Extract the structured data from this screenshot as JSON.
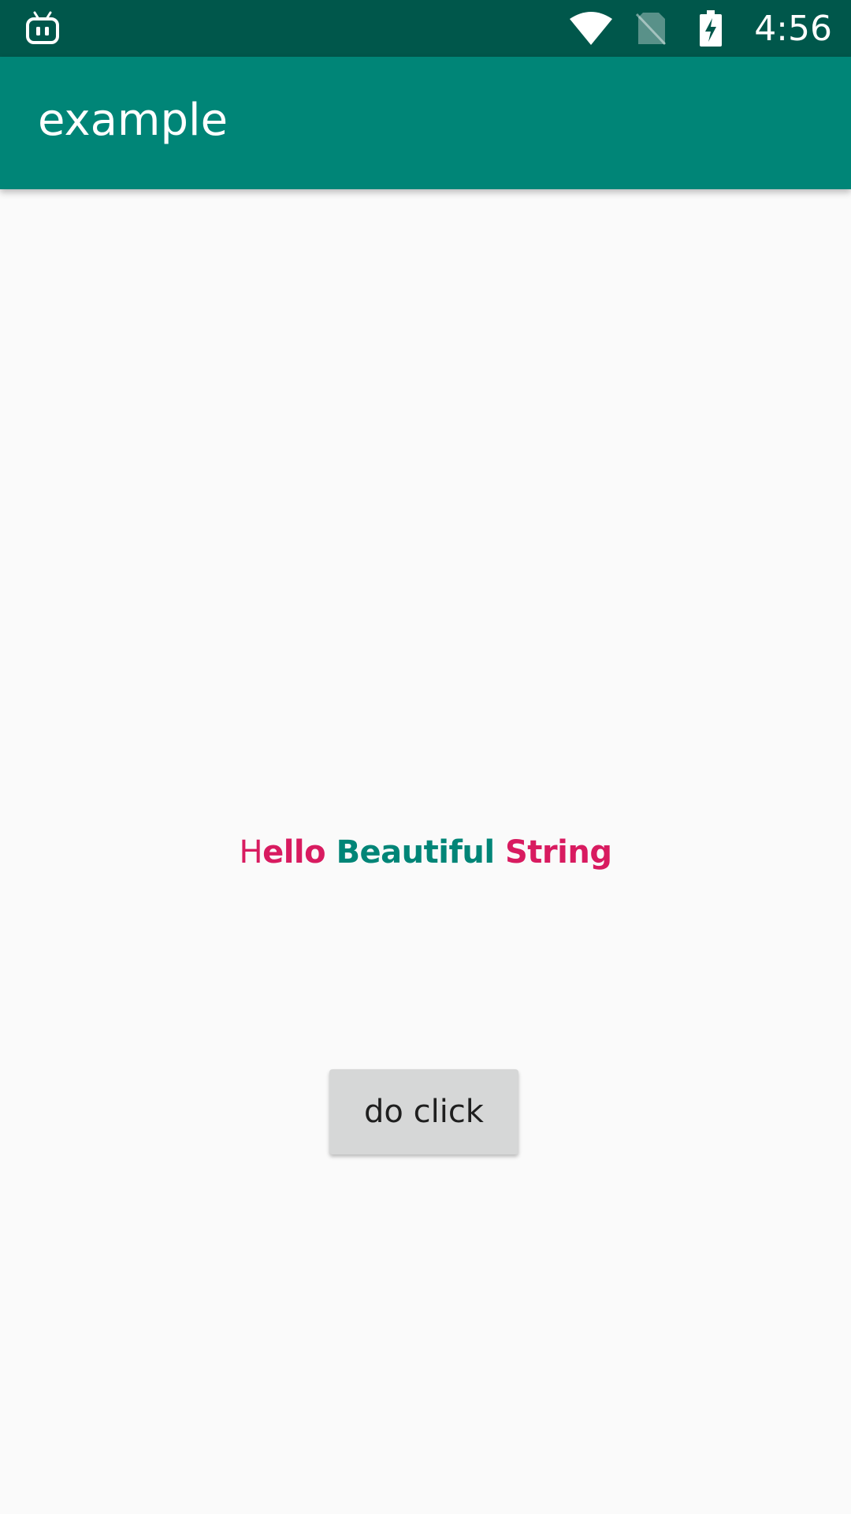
{
  "status_bar": {
    "time": "4:56",
    "left_icon": "android-debug-icon",
    "icons": [
      "wifi-icon",
      "no-sim-icon",
      "battery-charging-icon"
    ],
    "background_color": "#00574b"
  },
  "app_bar": {
    "title": "example",
    "background_color": "#008577"
  },
  "main": {
    "styled_text": {
      "segments": [
        {
          "text": "H",
          "color": "#d81b60",
          "bold": false
        },
        {
          "text": "ello ",
          "color": "#d81b60",
          "bold": true
        },
        {
          "text": "Beautiful ",
          "color": "#008577",
          "bold": true
        },
        {
          "text": "String",
          "color": "#d81b60",
          "bold": true
        }
      ]
    },
    "button": {
      "label": "do click"
    }
  }
}
